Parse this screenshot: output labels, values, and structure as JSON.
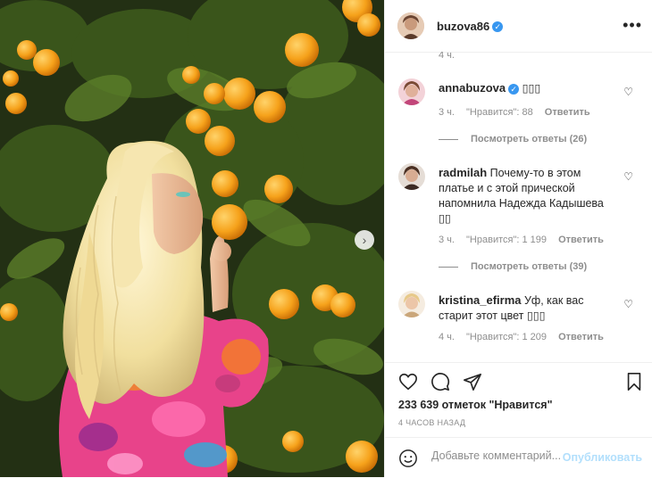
{
  "post": {
    "author": "buzova86",
    "image_alt": "Woman with blonde wavy hair in floral dress holding an orange under an orange tree"
  },
  "comments_top_partial": "4 ч.",
  "comments": [
    {
      "username": "annabuzova",
      "verified": true,
      "text": "▯▯▯",
      "time": "3 ч.",
      "likes": "\"Нравится\": 88",
      "reply": "Ответить",
      "view_replies": "Посмотреть ответы (26)"
    },
    {
      "username": "radmilah",
      "verified": false,
      "text": "Почему-то в этом платье и с этой прической напомнила Надежда Кадышева ▯▯",
      "time": "3 ч.",
      "likes": "\"Нравится\": 1 199",
      "reply": "Ответить",
      "view_replies": "Посмотреть ответы (39)"
    },
    {
      "username": "kristina_efirma",
      "verified": false,
      "text": "Уф, как вас старит этот цвет ▯▯▯",
      "time": "4 ч.",
      "likes": "\"Нравится\": 1 209",
      "reply": "Ответить"
    }
  ],
  "footer": {
    "likes": "233 639 отметок \"Нравится\"",
    "time_ago": "4 ЧАСОВ НАЗАД",
    "comment_placeholder": "Добавьте комментарий...",
    "post_button": "Опубликовать"
  },
  "icons": {
    "like": "heart-icon",
    "comment": "comment-icon",
    "share": "share-icon",
    "save": "bookmark-icon",
    "more": "more-icon",
    "emoji": "emoji-icon",
    "next": "chevron-right-icon"
  },
  "colors": {
    "verified": "#3897f0",
    "post_button": "#b2dffc",
    "muted": "#8e8e8e"
  }
}
